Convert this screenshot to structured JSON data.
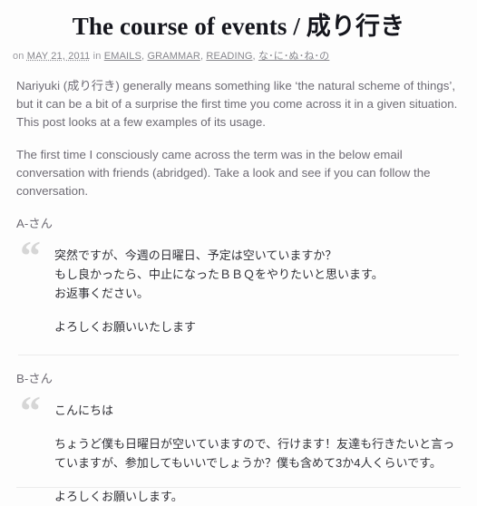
{
  "post": {
    "title": "The course of events / 成り行き",
    "meta": {
      "prefix": "on",
      "date": "MAY 21, 2011",
      "middle": "in",
      "categories": [
        "EMAILS",
        "GRAMMAR",
        "READING",
        "な･に･ぬ･ね･の"
      ],
      "separator": ", "
    },
    "paragraphs": [
      "Nariyuki (成り行き) generally means something like ‘the natural scheme of things’, but it can be a bit of a surprise the first time you come across it in a given situation. This post looks at a few examples of its usage.",
      "The first time I consciously came across the term was in the below email conversation with friends (abridged). Take a look and see if you can follow the conversation."
    ],
    "conversation": [
      {
        "speaker": "A-さん",
        "quote_icon": "double-quote-icon",
        "lines": [
          "突然ですが、今週の日曜日、予定は空いていますか？\nもし良かったら、中止になったＢＢＱをやりたいと思います。\nお返事ください。",
          "よろしくお願いいたします"
        ]
      },
      {
        "speaker": "B-さん",
        "quote_icon": "double-quote-icon",
        "lines": [
          "こんにちは",
          "ちょうど僕も日曜日が空いていますので、行けます！友達も行きたいと言っていますが、参加してもいいでしょうか？僕も含めて3か4人くらいです。",
          "よろしくお願いします。"
        ]
      }
    ]
  },
  "colors": {
    "background": "#fdfdfd",
    "title": "#15161d",
    "body_text": "#6e6b74",
    "quote_text": "#303036",
    "meta_text": "#8d8d92",
    "quote_mark": "#d6d6d6",
    "divider": "#ececec"
  }
}
